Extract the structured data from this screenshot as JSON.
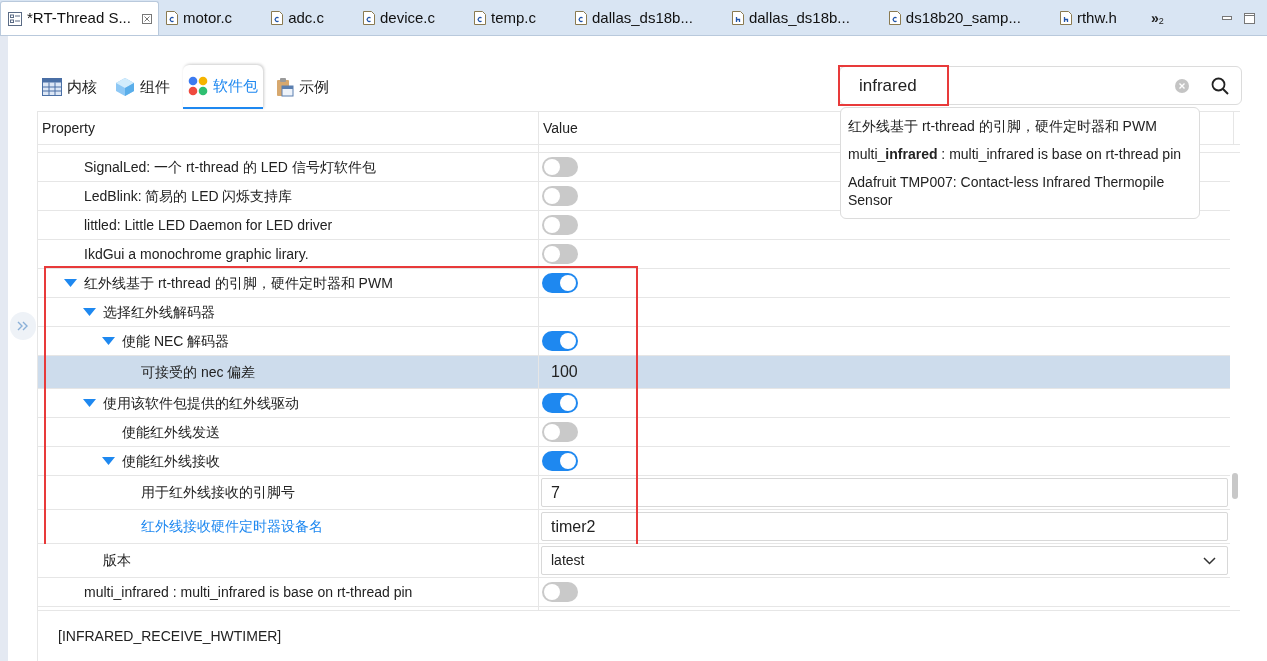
{
  "editor_tabs": [
    {
      "label": "*RT-Thread S...",
      "kind": "settings",
      "selected": true
    },
    {
      "label": "motor.c",
      "kind": "c",
      "selected": false
    },
    {
      "label": "adc.c",
      "kind": "c",
      "selected": false
    },
    {
      "label": "device.c",
      "kind": "c",
      "selected": false
    },
    {
      "label": "temp.c",
      "kind": "c",
      "selected": false
    },
    {
      "label": "dallas_ds18b...",
      "kind": "c",
      "selected": false
    },
    {
      "label": "dallas_ds18b...",
      "kind": "h",
      "selected": false
    },
    {
      "label": "ds18b20_samp...",
      "kind": "c",
      "selected": false
    },
    {
      "label": "rthw.h",
      "kind": "h",
      "selected": false
    }
  ],
  "overflow": {
    "symbol": "»",
    "count": "2"
  },
  "view_tabs": [
    {
      "label": "内核",
      "kind": "table",
      "selected": false
    },
    {
      "label": "组件",
      "kind": "cube",
      "selected": false
    },
    {
      "label": "软件包",
      "kind": "dots",
      "selected": true
    },
    {
      "label": "示例",
      "kind": "clipboard",
      "selected": false
    }
  ],
  "search": {
    "value": "infrared",
    "annotated": true,
    "suggestions": [
      "红外线基于 rt-thread 的引脚，硬件定时器和 PWM",
      "multi_**infrared** : multi_infrared is base on rt-thread pin",
      "Adafruit TMP007: Contact-less Infrared Thermopile Sensor"
    ]
  },
  "table": {
    "columns": [
      "Property",
      "Value"
    ],
    "rows": [
      {
        "label": "SignalLed: 一个 rt-thread 的 LED 信号灯软件包",
        "selected": false,
        "modified": false,
        "framed": false,
        "value": {
          "kind": "toggle",
          "on": false
        }
      },
      {
        "label": "LedBlink: 简易的 LED 闪烁支持库",
        "selected": false,
        "modified": false,
        "framed": false,
        "value": {
          "kind": "toggle",
          "on": false
        }
      },
      {
        "label": "littled: Little LED Daemon for LED driver",
        "selected": false,
        "modified": false,
        "framed": false,
        "value": {
          "kind": "toggle",
          "on": false
        }
      },
      {
        "label": "IkdGui a monochrome graphic lirary.",
        "selected": false,
        "modified": false,
        "framed": false,
        "value": {
          "kind": "toggle",
          "on": false
        }
      },
      {
        "label": "红外线基于 rt-thread 的引脚，硬件定时器和 PWM",
        "selected": false,
        "modified": false,
        "framed": true,
        "expanded": true,
        "value": {
          "kind": "toggle",
          "on": true
        },
        "children": [
          {
            "label": "选择红外线解码器",
            "selected": false,
            "modified": false,
            "framed": true,
            "expanded": true,
            "children": [
              {
                "label": "使能 NEC 解码器",
                "selected": false,
                "modified": false,
                "framed": true,
                "expanded": true,
                "value": {
                  "kind": "toggle",
                  "on": true
                },
                "children": [
                  {
                    "label": "可接受的 nec 偏差",
                    "selected": true,
                    "modified": false,
                    "framed": true,
                    "value": {
                      "kind": "text",
                      "text": "100"
                    }
                  }
                ]
              }
            ]
          },
          {
            "label": "使用该软件包提供的红外线驱动",
            "selected": false,
            "modified": false,
            "framed": true,
            "expanded": true,
            "value": {
              "kind": "toggle",
              "on": true
            },
            "children": [
              {
                "label": "使能红外线发送",
                "selected": false,
                "modified": false,
                "framed": true,
                "value": {
                  "kind": "toggle",
                  "on": false
                }
              },
              {
                "label": "使能红外线接收",
                "selected": false,
                "modified": false,
                "framed": true,
                "expanded": true,
                "value": {
                  "kind": "toggle",
                  "on": true
                },
                "children": [
                  {
                    "label": "用于红外线接收的引脚号",
                    "selected": false,
                    "modified": false,
                    "framed": true,
                    "value": {
                      "kind": "field",
                      "value": "7"
                    }
                  },
                  {
                    "label": "红外线接收硬件定时器设备名",
                    "selected": false,
                    "modified": true,
                    "framed": true,
                    "value": {
                      "kind": "field",
                      "value": "timer2"
                    }
                  }
                ]
              }
            ]
          },
          {
            "label": "版本",
            "selected": false,
            "modified": false,
            "framed": false,
            "value": {
              "kind": "dropdown",
              "value": "latest"
            }
          }
        ]
      },
      {
        "label": "multi_infrared : multi_infrared is base on rt-thread pin",
        "selected": false,
        "modified": false,
        "framed": false,
        "value": {
          "kind": "toggle",
          "on": false
        }
      }
    ]
  },
  "description": "[INFRARED_RECEIVE_HWTIMER]"
}
